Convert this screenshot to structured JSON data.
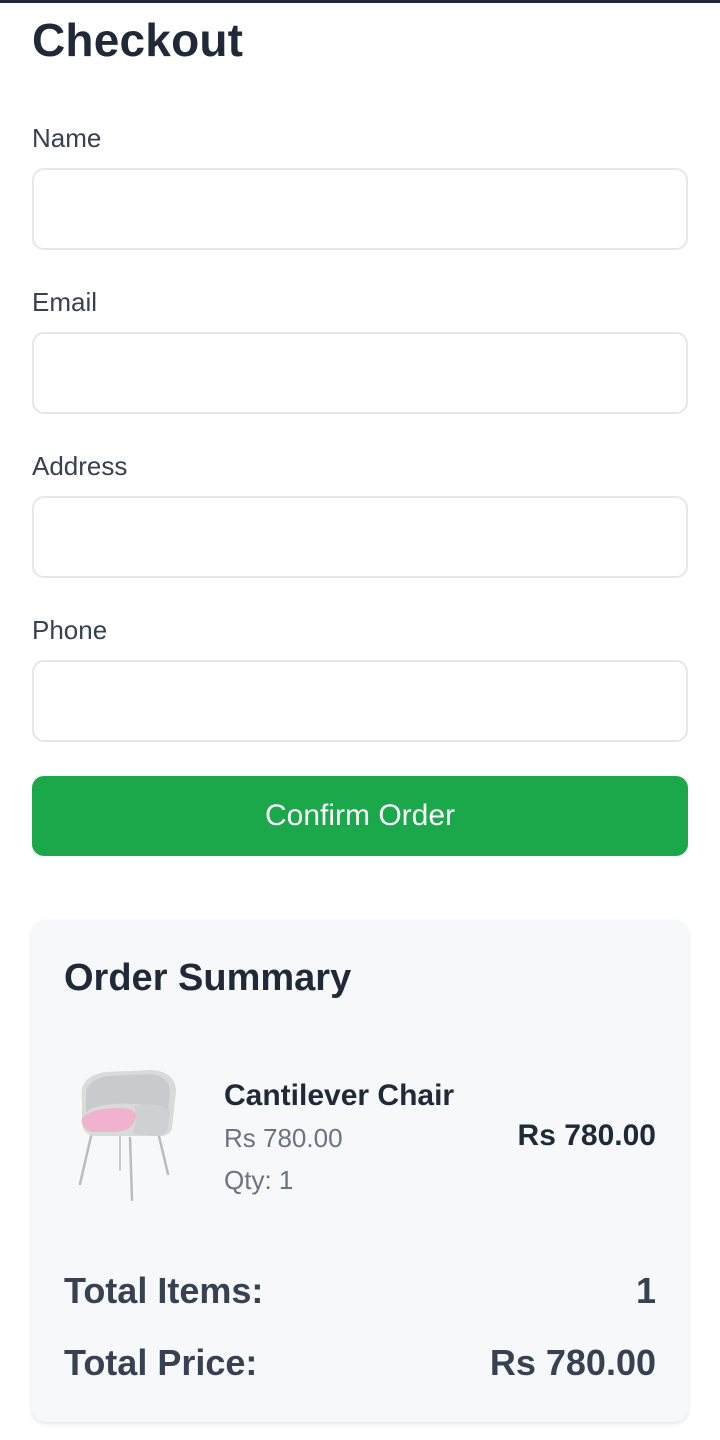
{
  "header": {
    "title": "Checkout"
  },
  "form": {
    "fields": [
      {
        "label": "Name",
        "value": "",
        "placeholder": ""
      },
      {
        "label": "Email",
        "value": "",
        "placeholder": ""
      },
      {
        "label": "Address",
        "value": "",
        "placeholder": ""
      },
      {
        "label": "Phone",
        "value": "",
        "placeholder": ""
      }
    ],
    "submit_label": "Confirm Order"
  },
  "summary": {
    "title": "Order Summary",
    "items": [
      {
        "name": "Cantilever Chair",
        "unit_price": "Rs 780.00",
        "qty_label": "Qty:",
        "qty": "1",
        "line_total": "Rs 780.00",
        "image_icon": "chair-image"
      }
    ],
    "total_items_label": "Total Items:",
    "total_items": "1",
    "total_price_label": "Total Price:",
    "total_price": "Rs 780.00"
  },
  "colors": {
    "accent": "#1ba84a",
    "text": "#1f2937",
    "muted": "#6b7280",
    "card_bg": "#f7f8fa",
    "input_border": "#e5e7eb"
  }
}
